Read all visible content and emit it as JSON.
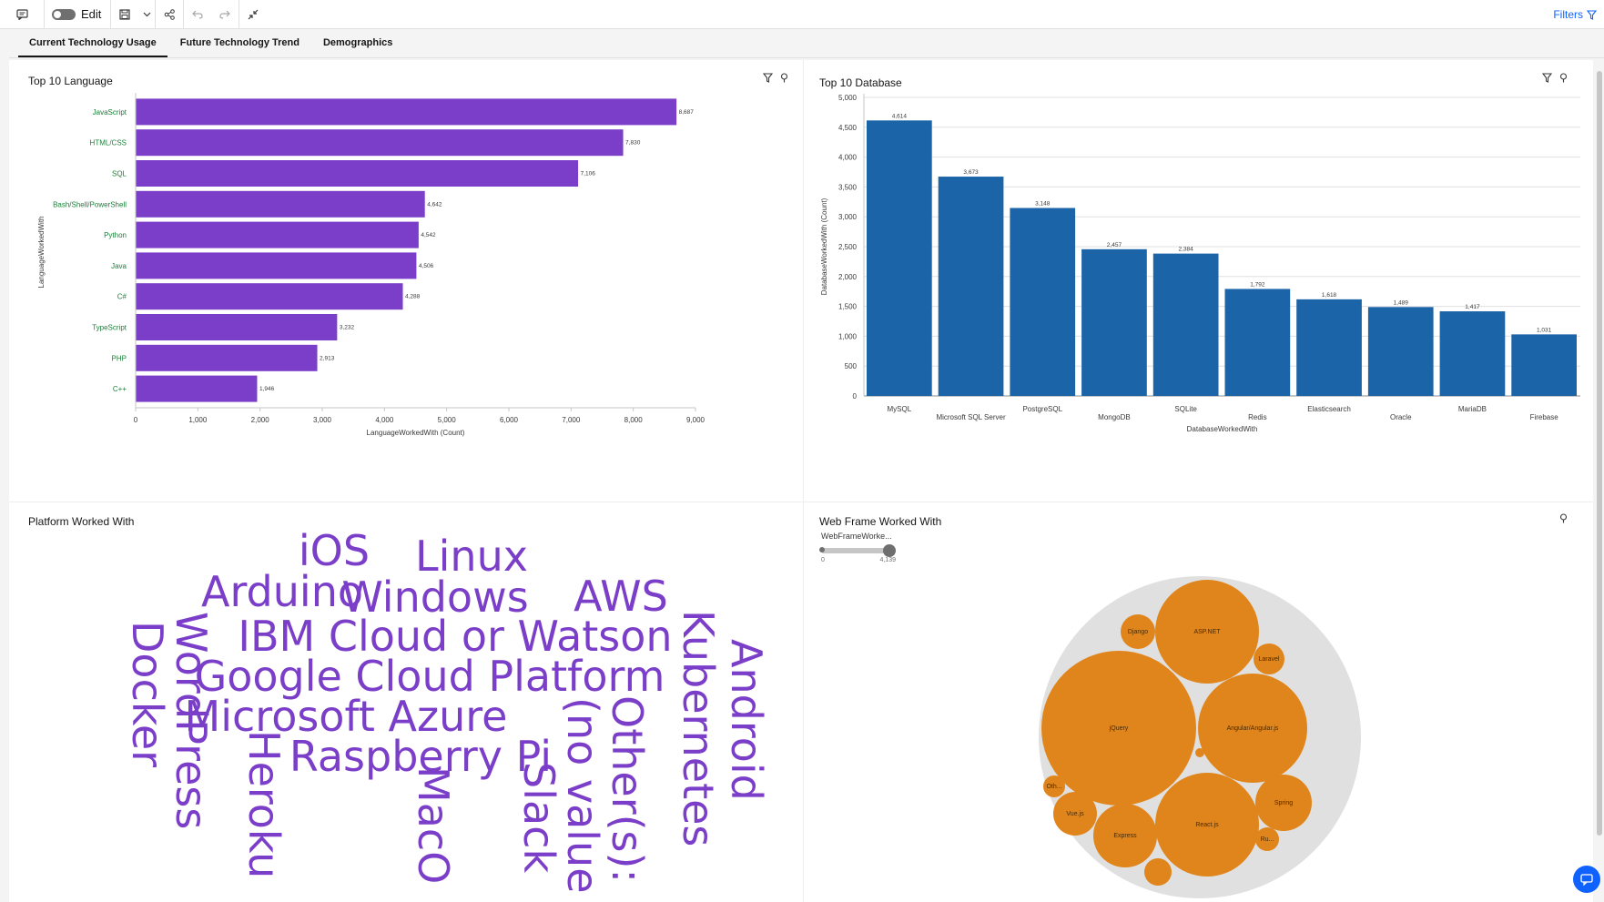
{
  "toolbar": {
    "edit_label": "Edit",
    "filters_label": "Filters"
  },
  "tabs": [
    {
      "label": "Current Technology Usage",
      "active": true
    },
    {
      "label": "Future Technology Trend",
      "active": false
    },
    {
      "label": "Demographics",
      "active": false
    }
  ],
  "panels": {
    "language": {
      "title": "Top 10 Language"
    },
    "database": {
      "title": "Top 10 Database"
    },
    "platform": {
      "title": "Platform Worked With"
    },
    "webframe": {
      "title": "Web Frame Worked With",
      "slider_label": "WebFrameWorke...",
      "slider_min": "0",
      "slider_max": "4,139"
    }
  },
  "colors": {
    "language_bar": "#7b3ec9",
    "database_bar": "#1c64a8",
    "word_cloud": "#7b3ec9",
    "bubble": "#e0851c",
    "bubble_container": "#e0e0e0",
    "accent": "#0f62fe"
  },
  "icons": {
    "comment": "comment-icon",
    "save": "save-icon",
    "share": "share-icon",
    "undo": "undo-icon",
    "redo": "redo-icon",
    "collapse": "collapse-icon",
    "filter": "filter-icon",
    "pin": "pin-icon",
    "chat": "chat-icon"
  },
  "chart_data": [
    {
      "type": "bar",
      "orientation": "horizontal",
      "title": "Top 10 Language",
      "xlabel": "LanguageWorkedWith (Count)",
      "ylabel": "LanguageWorkedWith",
      "categories": [
        "JavaScript",
        "HTML/CSS",
        "SQL",
        "Bash/Shell/PowerShell",
        "Python",
        "Java",
        "C#",
        "TypeScript",
        "PHP",
        "C++"
      ],
      "values": [
        8687,
        7830,
        7106,
        4642,
        4542,
        4506,
        4288,
        3232,
        2913,
        1946
      ],
      "value_labels": [
        "8,687",
        "7,830",
        "7,106",
        "4,642",
        "4,542",
        "4,506",
        "4,288",
        "3,232",
        "2,913",
        "1,946"
      ],
      "xlim": [
        0,
        9000
      ],
      "xticks": [
        "0",
        "1,000",
        "2,000",
        "3,000",
        "4,000",
        "5,000",
        "6,000",
        "7,000",
        "8,000",
        "9,000"
      ]
    },
    {
      "type": "bar",
      "orientation": "vertical",
      "title": "Top 10 Database",
      "xlabel": "DatabaseWorkedWith",
      "ylabel": "DatabaseWorkedWith (Count)",
      "categories": [
        "MySQL",
        "Microsoft SQL Server",
        "PostgreSQL",
        "MongoDB",
        "SQLite",
        "Redis",
        "Elasticsearch",
        "Oracle",
        "MariaDB",
        "Firebase"
      ],
      "values": [
        4614,
        3673,
        3148,
        2457,
        2384,
        1792,
        1618,
        1489,
        1417,
        1031
      ],
      "value_labels": [
        "4,614",
        "3,673",
        "3,148",
        "2,457",
        "2,384",
        "1,792",
        "1,618",
        "1,489",
        "1,417",
        "1,031"
      ],
      "ylim": [
        0,
        5000
      ],
      "yticks": [
        "0",
        "500",
        "1,000",
        "1,500",
        "2,000",
        "2,500",
        "3,000",
        "3,500",
        "4,000",
        "4,500",
        "5,000"
      ],
      "grid": true
    },
    {
      "type": "word_cloud",
      "title": "Platform Worked With",
      "words": [
        "iOS",
        "Linux",
        "Arduino",
        "Windows",
        "AWS",
        "IBM Cloud or Watson",
        "Google Cloud Platform",
        "Microsoft Azure",
        "Raspberry Pi",
        "Docker",
        "WordPress",
        "Heroku",
        "MacO",
        "Slack",
        "(no value",
        "Other(s):",
        "Kubernetes",
        "Android"
      ]
    },
    {
      "type": "bubble",
      "title": "Web Frame Worked With",
      "labels": [
        "jQuery",
        "ASP.NET",
        "Angular/Angular.js",
        "React.js",
        "Django",
        "Laravel",
        "Spring",
        "Express",
        "Vue.js",
        "Oth...",
        "Ru..."
      ]
    }
  ]
}
